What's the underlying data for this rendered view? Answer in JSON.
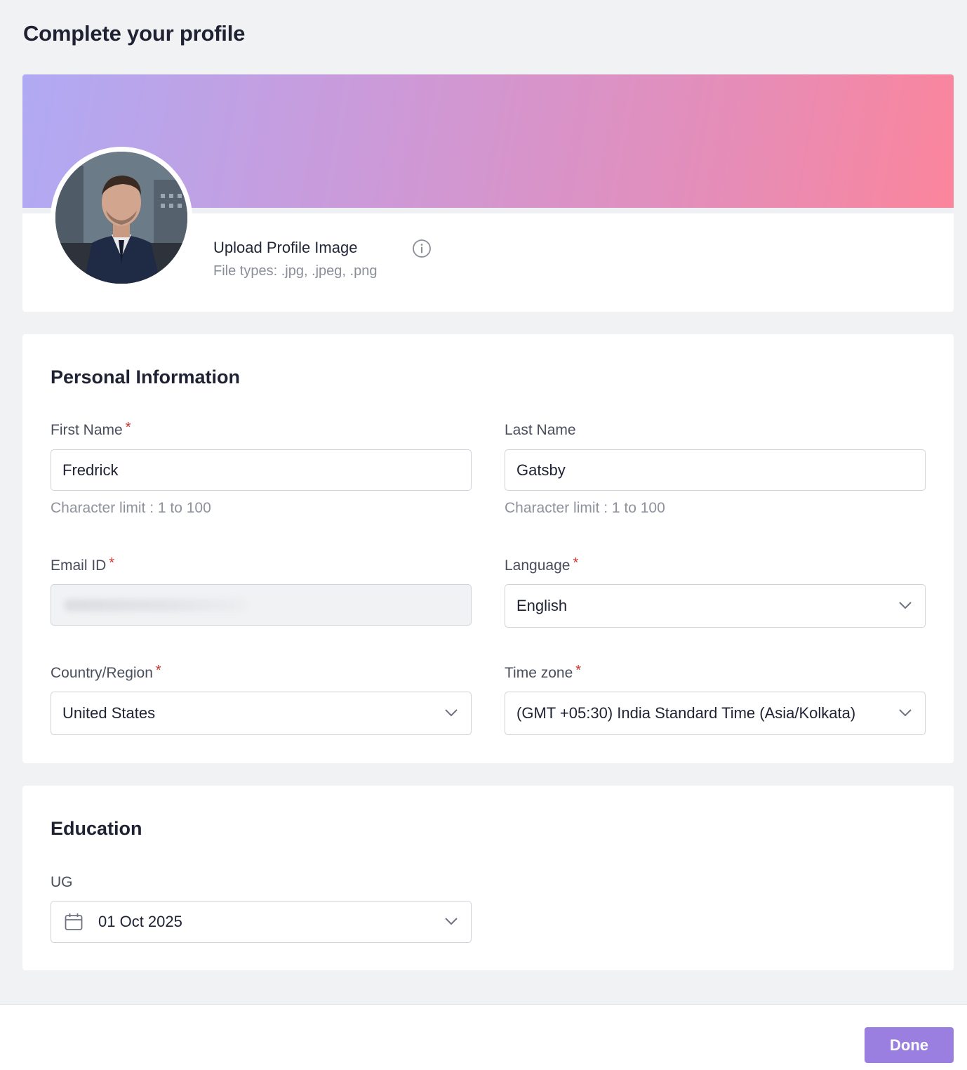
{
  "page": {
    "title": "Complete your profile"
  },
  "profile_image": {
    "upload_label": "Upload Profile Image",
    "file_types": "File types: .jpg, .jpeg, .png",
    "info_icon": "info-icon"
  },
  "personal_info": {
    "title": "Personal Information",
    "first_name": {
      "label": "First Name",
      "required": "*",
      "value": "Fredrick",
      "helper": "Character limit : 1 to 100"
    },
    "last_name": {
      "label": "Last Name",
      "value": "Gatsby",
      "helper": "Character limit : 1 to 100"
    },
    "email": {
      "label": "Email ID",
      "required": "*",
      "value": ""
    },
    "language": {
      "label": "Language",
      "required": "*",
      "value": "English"
    },
    "country": {
      "label": "Country/Region",
      "required": "*",
      "value": "United States"
    },
    "timezone": {
      "label": "Time zone",
      "required": "*",
      "value": "(GMT +05:30) India Standard Time (Asia/Kolkata)"
    }
  },
  "education": {
    "title": "Education",
    "ug": {
      "label": "UG",
      "value": "01 Oct 2025",
      "icon": "calendar-icon"
    }
  },
  "footer": {
    "done_label": "Done"
  },
  "colors": {
    "accent": "#9b7fe0",
    "required": "#d0342c",
    "banner_start": "#b0aaf4",
    "banner_end": "#fb859c"
  }
}
